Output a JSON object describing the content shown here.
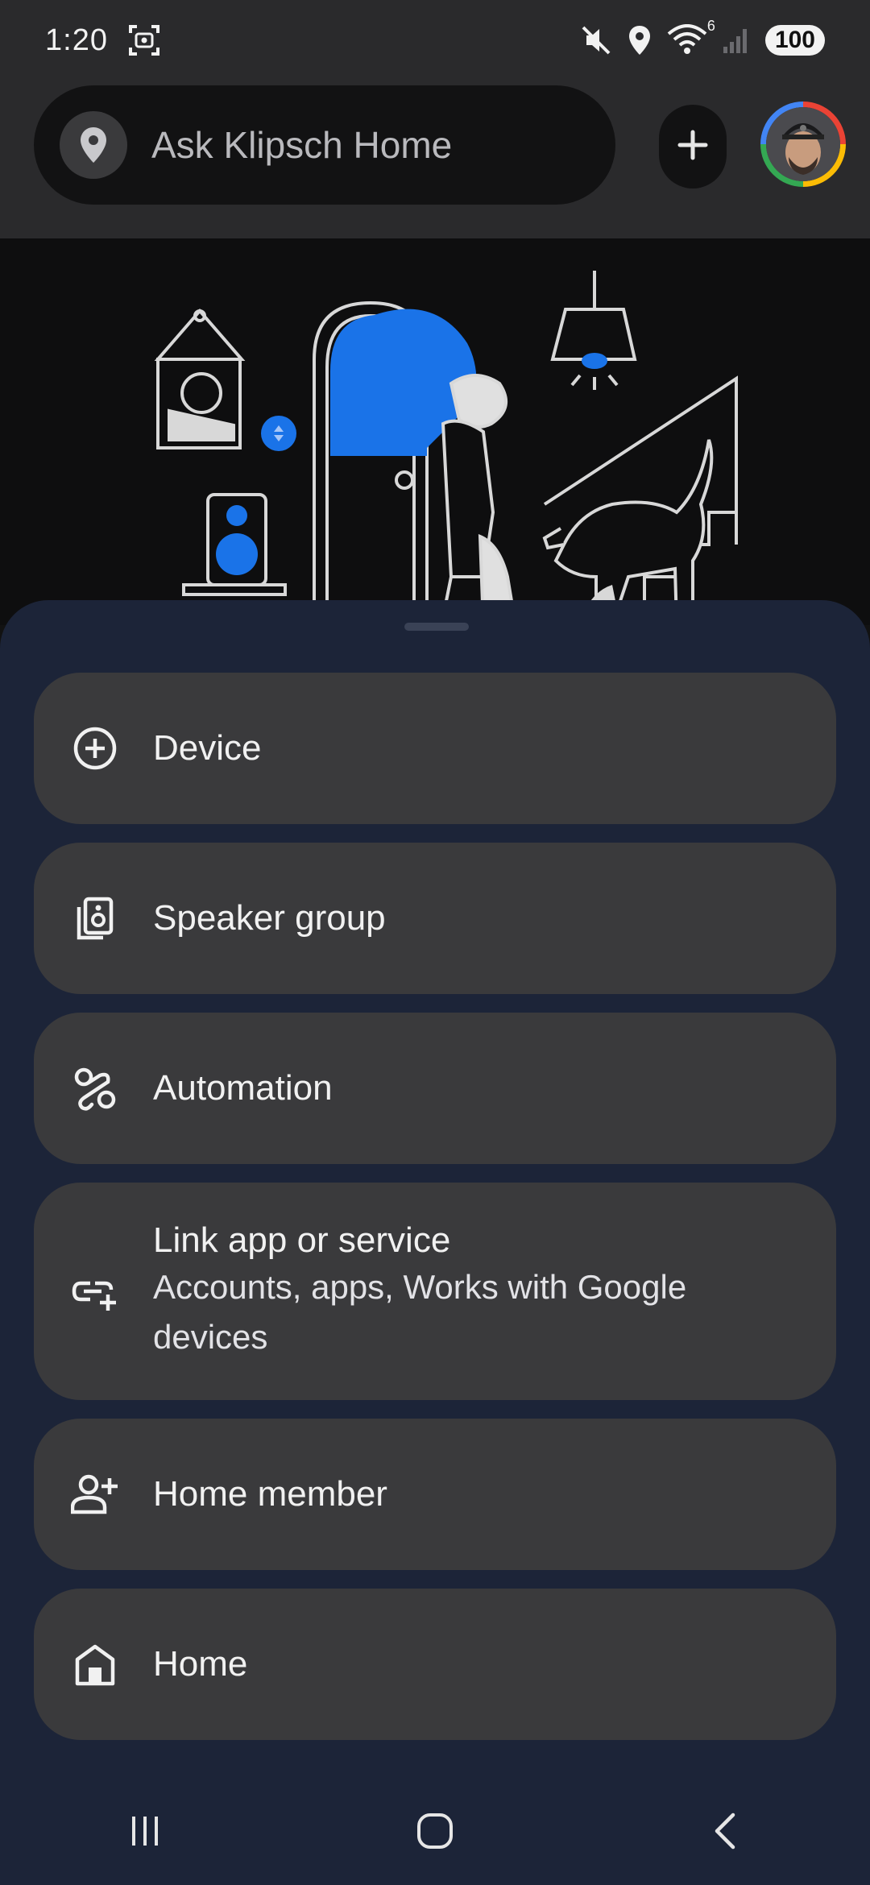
{
  "status_bar": {
    "time": "1:20",
    "battery": "100",
    "wifi_badge": "6",
    "icons": [
      "screenshot-icon",
      "mute-icon",
      "location-icon",
      "wifi-icon",
      "signal-icon",
      "battery-icon"
    ]
  },
  "search": {
    "placeholder": "Ask Klipsch Home"
  },
  "top_bar": {
    "add_icon": "plus-icon",
    "avatar": "user-avatar"
  },
  "menu": {
    "items": [
      {
        "label": "Device",
        "icon": "add-circle-icon"
      },
      {
        "label": "Speaker group",
        "icon": "speaker-group-icon"
      },
      {
        "label": "Automation",
        "icon": "automation-icon"
      },
      {
        "label": "Link app or service",
        "sublabel": "Accounts, apps, Works with Google devices",
        "icon": "link-add-icon"
      },
      {
        "label": "Home member",
        "icon": "person-add-icon"
      },
      {
        "label": "Home",
        "icon": "home-icon"
      }
    ]
  },
  "nav": {
    "icons": [
      "recents-icon",
      "home-nav-icon",
      "back-icon"
    ]
  },
  "colors": {
    "sheet_bg": "#1c2438",
    "item_bg": "#3a3a3c",
    "accent_blue": "#1a73e8",
    "app_bar": "#2a2a2c"
  }
}
